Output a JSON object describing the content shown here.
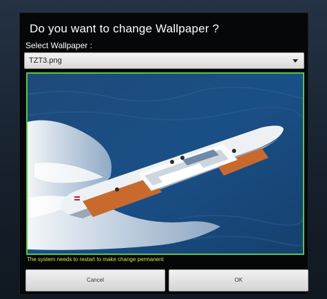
{
  "dialog": {
    "title": "Do you want to change Wallpaper ?",
    "select_label": "Select Wallpaper :",
    "selected_wallpaper": "TZT3.png",
    "restart_note": "The system needs to restart to make change permanent",
    "cancel_label": "Cancel",
    "ok_label": "OK"
  },
  "colors": {
    "preview_border": "#55c84a",
    "note_text": "#e8e03a",
    "dialog_background": "#050708"
  },
  "icons": {
    "dropdown": "chevron-down-icon"
  }
}
